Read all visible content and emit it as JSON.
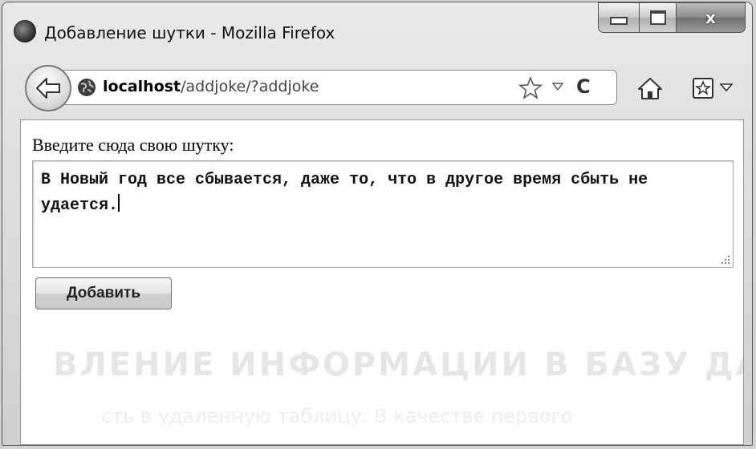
{
  "window": {
    "title": "Добавление шутки - Mozilla Firefox",
    "close_glyph": "x"
  },
  "navbar": {
    "url_host": "localhost",
    "url_path": "/addjoke/?addjoke",
    "reload_glyph": "C"
  },
  "icons": {
    "app": "firefox-icon",
    "back": "back-arrow-icon",
    "site": "globe-icon",
    "bookmark_star": "star-icon",
    "history_drop": "dropmarker-icon",
    "reload": "reload-icon",
    "home": "home-icon",
    "bookmarks": "bookmarks-menu-icon"
  },
  "form": {
    "label": "Введите сюда свою шутку:",
    "joke_text": "В Новый год все сбывается, даже то, что в другое время сбыть не удается.",
    "submit_label": "Добавить"
  },
  "colors": {
    "chrome": "#d4d4d4",
    "page_bg": "#ffffff",
    "text": "#111111"
  }
}
